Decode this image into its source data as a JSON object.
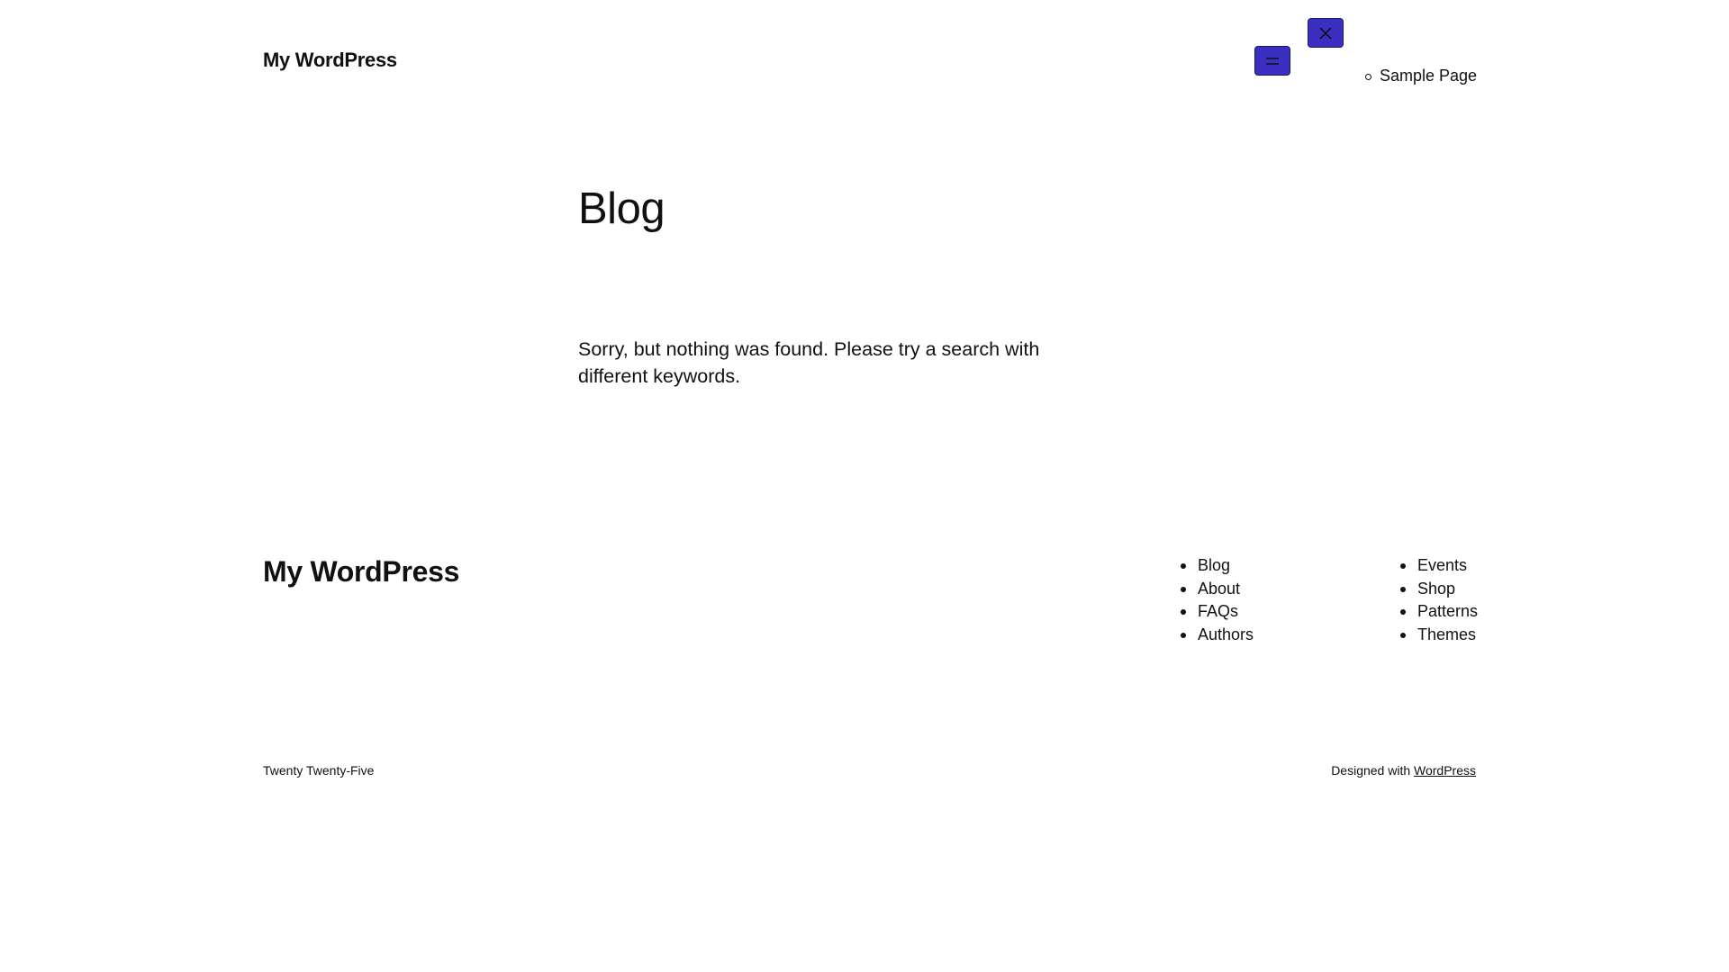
{
  "header": {
    "site_title": "My WordPress",
    "nav_items": [
      "Sample Page"
    ],
    "open_menu_icon": "menu-icon",
    "close_menu_icon": "close-icon",
    "button_color": "#3b2fc1"
  },
  "main": {
    "heading": "Blog",
    "empty_message": "Sorry, but nothing was found. Please try a search with different keywords."
  },
  "footer": {
    "site_title": "My WordPress",
    "nav_column_1": [
      "Blog",
      "About",
      "FAQs",
      "Authors"
    ],
    "nav_column_2": [
      "Events",
      "Shop",
      "Patterns",
      "Themes"
    ],
    "theme_name": "Twenty Twenty-Five",
    "designed_with_text": "Designed with",
    "designed_with_link": "WordPress"
  }
}
